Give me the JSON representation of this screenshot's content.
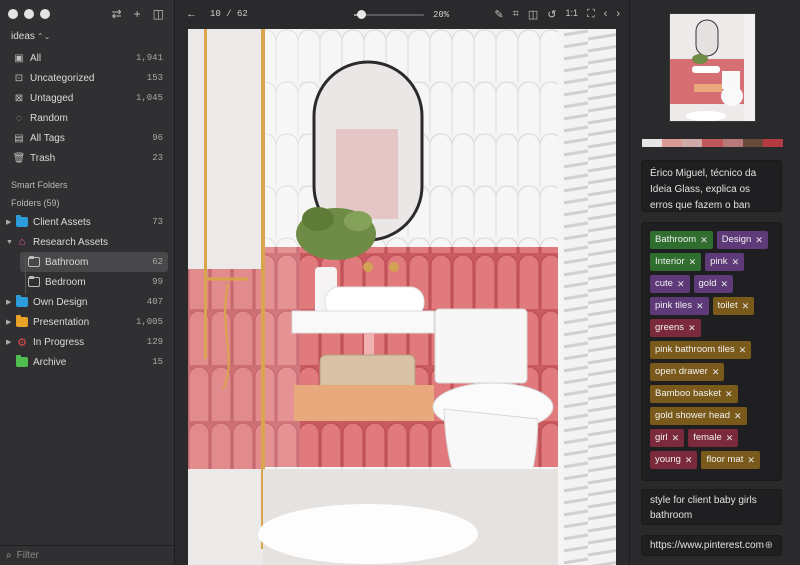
{
  "library": {
    "name": "ideas"
  },
  "nav": [
    {
      "label": "All",
      "count": "1,941",
      "icon": "all-items-icon"
    },
    {
      "label": "Uncategorized",
      "count": "153",
      "icon": "uncategorized-icon"
    },
    {
      "label": "Untagged",
      "count": "1,045",
      "icon": "untagged-icon"
    },
    {
      "label": "Random",
      "count": "",
      "icon": "random-bulb-icon"
    },
    {
      "label": "All Tags",
      "count": "96",
      "icon": "tags-icon"
    },
    {
      "label": "Trash",
      "count": "23",
      "icon": "trash-icon"
    }
  ],
  "smart_folders_label": "Smart Folders",
  "folders_label": "Folders (59)",
  "folders": [
    {
      "label": "Client Assets",
      "count": "73",
      "color": "#2e9bdc"
    },
    {
      "label": "Research Assets",
      "count": "",
      "color": "#e7579a"
    },
    {
      "label": "Bathroom",
      "count": "62",
      "color": ""
    },
    {
      "label": "Bedroom",
      "count": "99",
      "color": ""
    },
    {
      "label": "Own Design",
      "count": "407",
      "color": "#2e9bdc"
    },
    {
      "label": "Presentation",
      "count": "1,005",
      "color": "#e8a227"
    },
    {
      "label": "In Progress",
      "count": "129",
      "color": "#e5484d"
    },
    {
      "label": "Archive",
      "count": "15",
      "color": "#4fbf4f"
    }
  ],
  "filter_placeholder": "Filter",
  "toolbar": {
    "pager": "10 / 62",
    "zoom": "20%",
    "zoom_level": 0.1
  },
  "palette": [
    "#e7e4e4",
    "#d99a94",
    "#cfaaa8",
    "#c0575a",
    "#b8797a",
    "#6b4a3e",
    "#b23a40"
  ],
  "inspector": {
    "description": "Érico Miguel, técnico da Ideia Glass, explica os erros que fazem o ban",
    "tags": [
      {
        "label": "Bathroom",
        "color": "#2f6e2f"
      },
      {
        "label": "Design",
        "color": "#5e3a78"
      },
      {
        "label": "Interior",
        "color": "#2f6e2f"
      },
      {
        "label": "pink",
        "color": "#5e3a78"
      },
      {
        "label": "cute",
        "color": "#5e3a78"
      },
      {
        "label": "gold",
        "color": "#5e3a78"
      },
      {
        "label": "pink tiles",
        "color": "#5e3a78"
      },
      {
        "label": "toilet",
        "color": "#7a5a1a"
      },
      {
        "label": "greens",
        "color": "#7a2a3a"
      },
      {
        "label": "pink bathroom tiles",
        "color": "#7a5a1a"
      },
      {
        "label": "open drawer",
        "color": "#7a5a1a"
      },
      {
        "label": "Bamboo basket",
        "color": "#7a5a1a"
      },
      {
        "label": "gold shower head",
        "color": "#7a5a1a"
      },
      {
        "label": "girl",
        "color": "#7a2a3a"
      },
      {
        "label": "female",
        "color": "#7a2a3a"
      },
      {
        "label": "young",
        "color": "#7a2a3a"
      },
      {
        "label": "floor mat",
        "color": "#7a5a1a"
      }
    ],
    "note": "style for client baby girls bathroom",
    "url": "https://www.pinterest.com"
  }
}
